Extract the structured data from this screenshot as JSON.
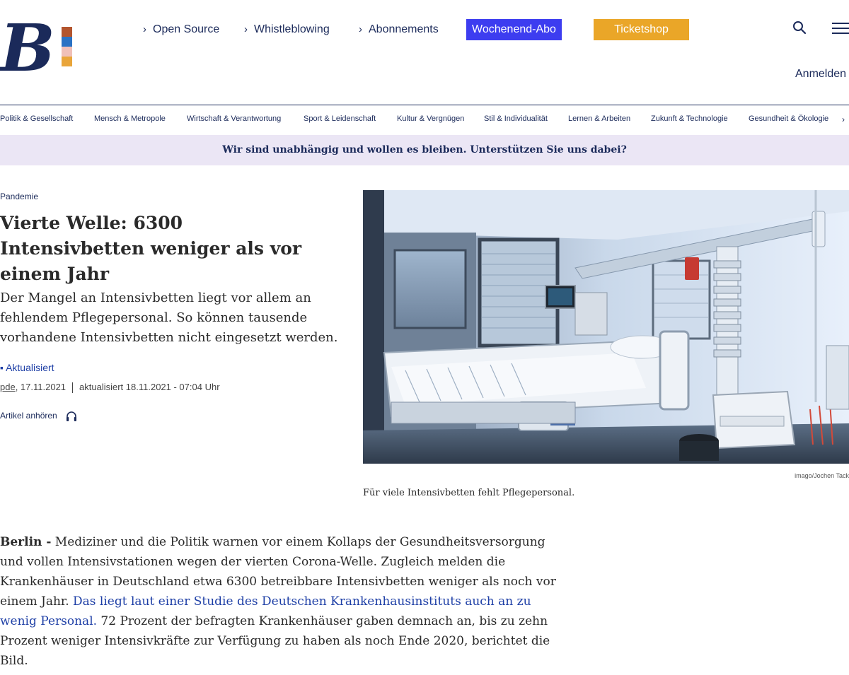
{
  "brand": {
    "logo_colors": [
      "#b3552e",
      "#2a72c4",
      "#f0c0b8",
      "#e9a53a"
    ],
    "navy": "#1b2a5a"
  },
  "topnav": {
    "items": [
      {
        "label": "Open Source"
      },
      {
        "label": "Whistleblowing"
      },
      {
        "label": "Abonnements"
      }
    ],
    "abo_button": {
      "label": "Wochenend-Abo",
      "color": "#3d3df0"
    },
    "ticket_button": {
      "label": "Ticketshop",
      "color": "#eaa628"
    },
    "login": "Anmelden"
  },
  "categories": [
    "Politik & Gesellschaft",
    "Mensch & Metropole",
    "Wirtschaft & Verantwortung",
    "Sport & Leidenschaft",
    "Kultur & Vergnügen",
    "Stil & Individualität",
    "Lernen & Arbeiten",
    "Zukunft & Technologie",
    "Gesundheit & Ökologie"
  ],
  "support_bar": {
    "text": "Wir sind unabhängig und wollen es bleiben. Unterstützen Sie uns dabei?",
    "background": "#ebe6f5"
  },
  "article": {
    "kicker": "Pandemie",
    "headline": "Vierte Welle: 6300 Intensivbetten weniger als vor einem Jahr",
    "teaser": "Der Mangel an Intensivbetten liegt vor allem an fehlendem Pflegepersonal. So können tausende vorhandene Intensivbetten nicht eingesetzt werden.",
    "update_label": "▪ Aktualisiert",
    "author": "pde",
    "date": ", 17.11.2021",
    "updated": "aktualisiert 18.11.2021 - 07:04 Uhr",
    "listen": "Artikel anhören",
    "image_credit": "imago/Jochen Tack",
    "image_caption": "Für viele Intensivbetten fehlt Pflegepersonal.",
    "body": {
      "lead": "Berlin -",
      "text1": " Mediziner und die Politik warnen vor einem Kollaps der Gesundheitsversorgung und vollen Intensivstationen wegen der vierten Corona-Welle. Zugleich melden die Krankenhäuser in Deutschland etwa 6300 betreibbare Intensivbetten weniger als noch vor einem Jahr. ",
      "link": "Das liegt laut einer Studie des Deutschen Krankenhausinstituts auch an zu wenig Personal.",
      "text2": " 72 Prozent der befragten Krankenhäuser gaben demnach an, bis zu zehn Prozent weniger Intensivkräfte zur Verfügung zu haben als noch Ende 2020, berichtet die Bild."
    }
  }
}
